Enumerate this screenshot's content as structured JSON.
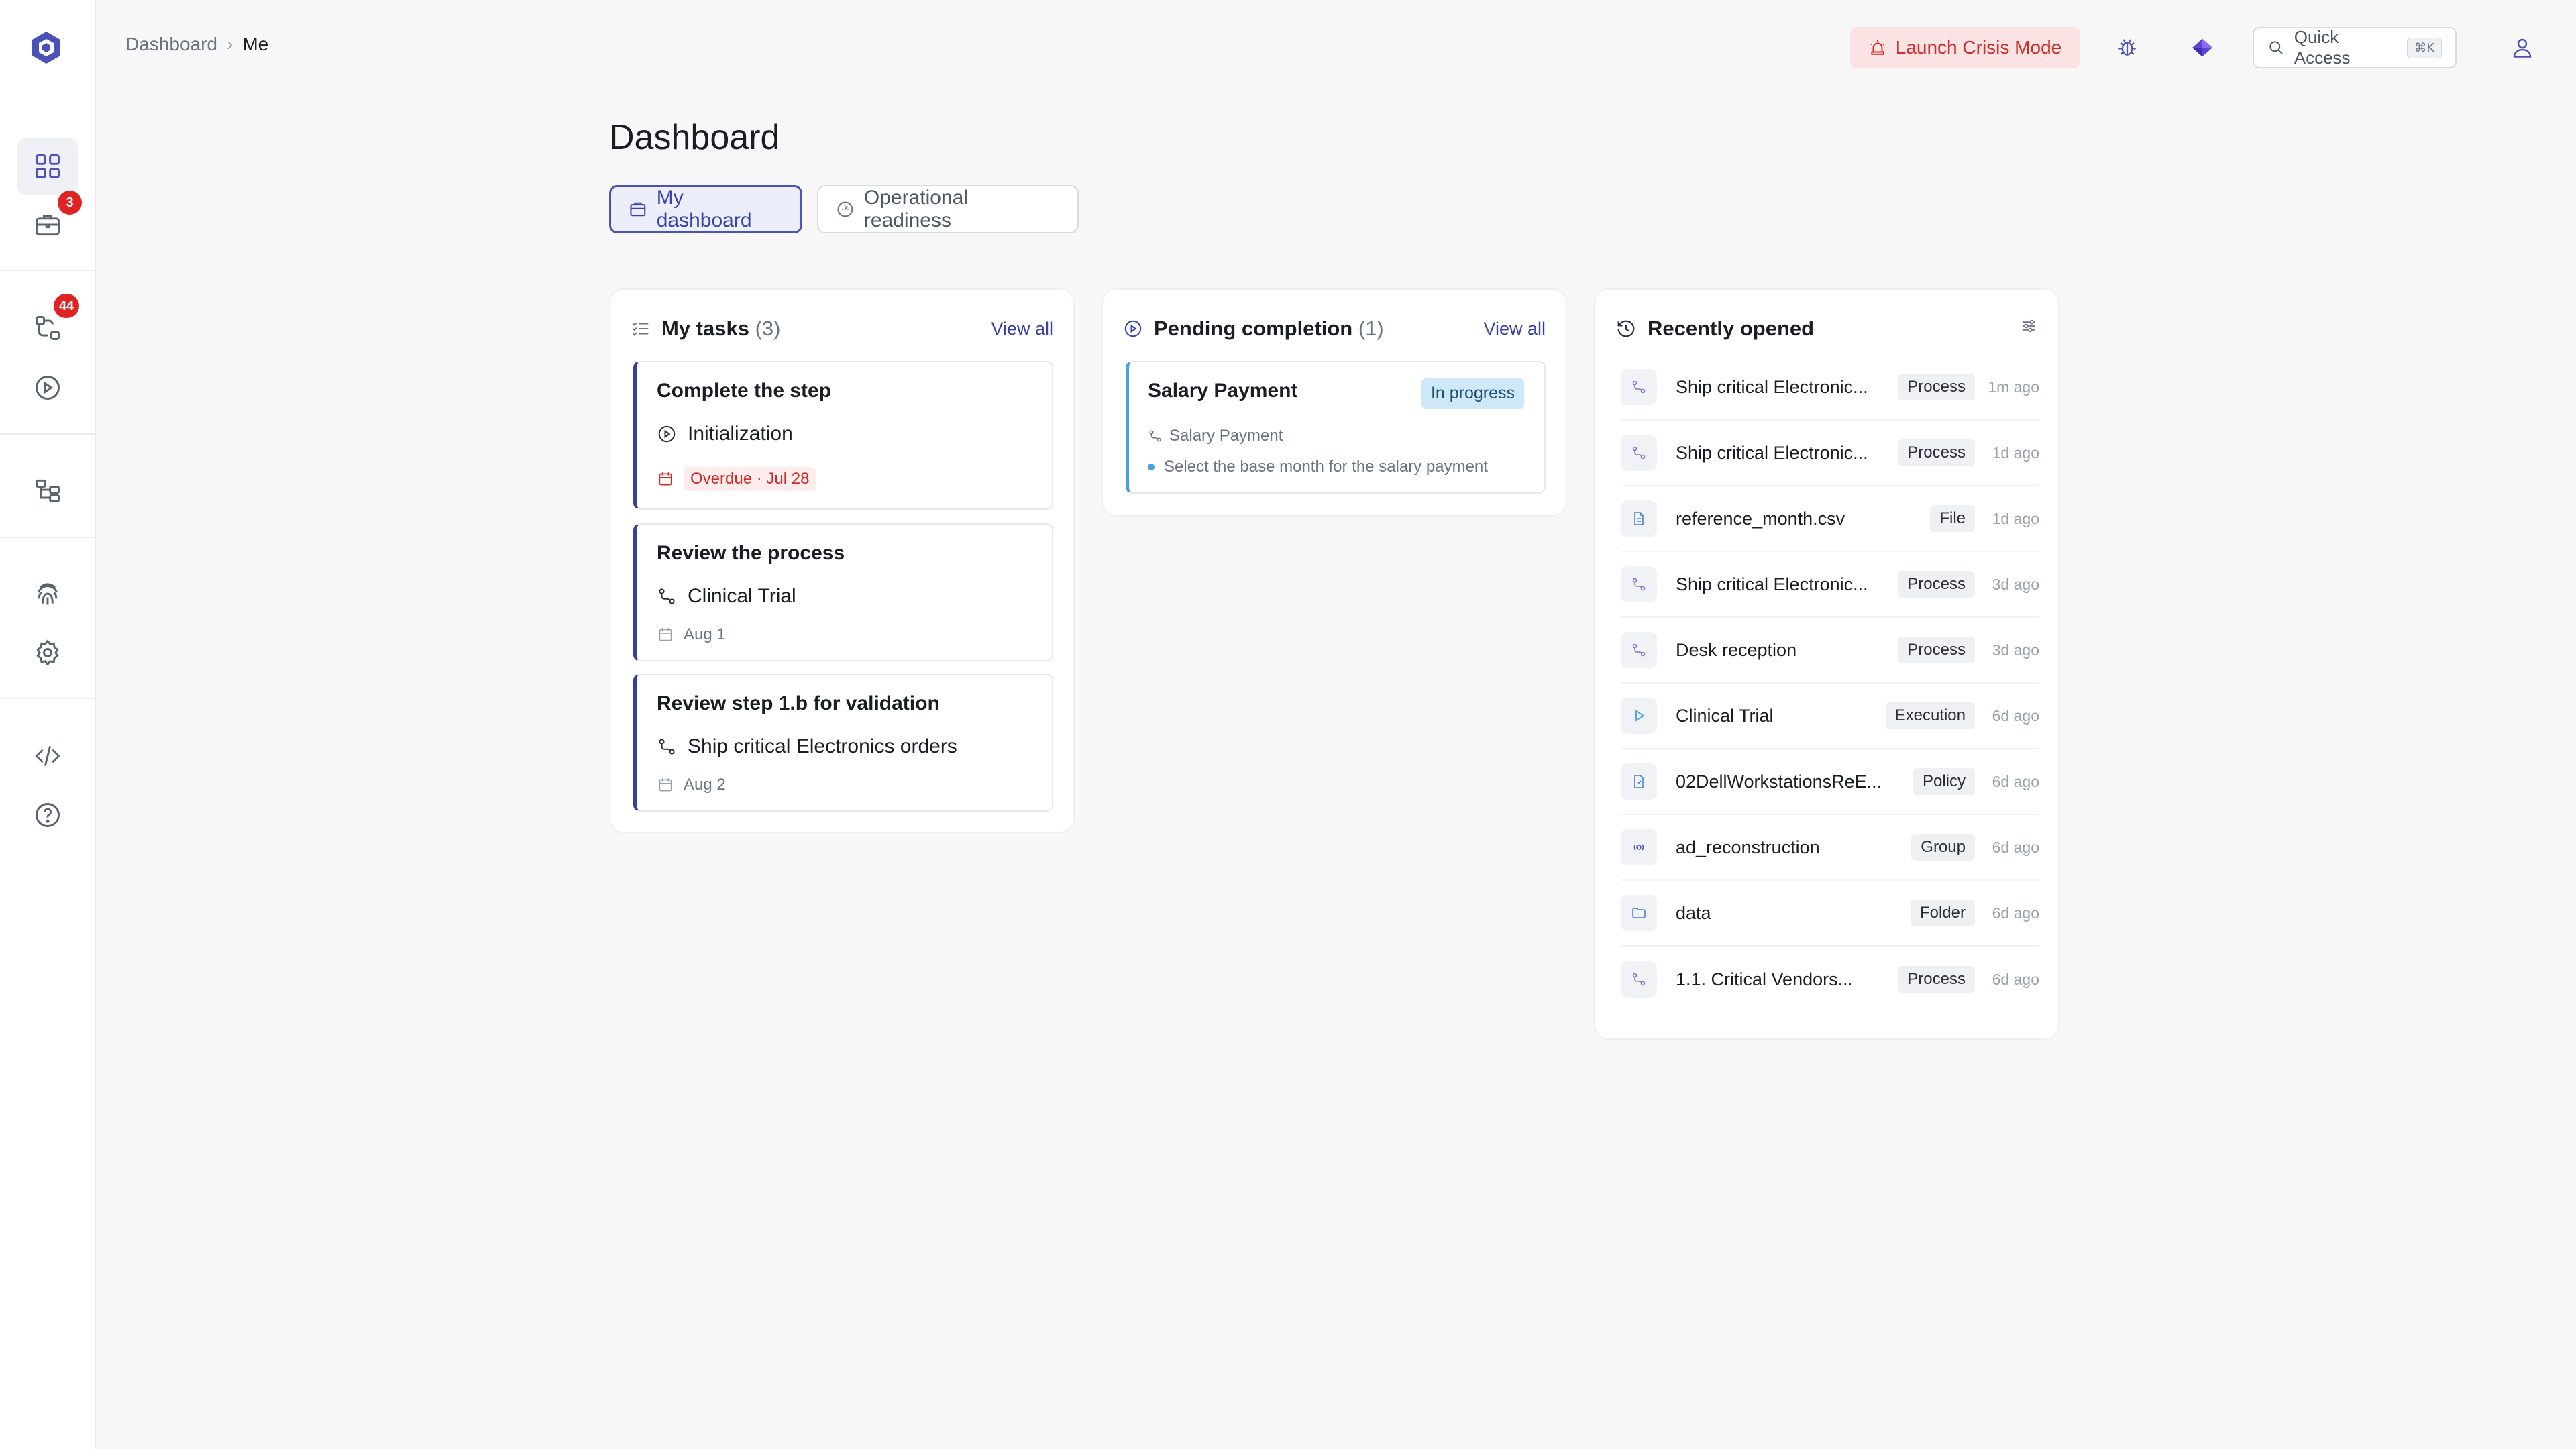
{
  "breadcrumb": {
    "root": "Dashboard",
    "current": "Me"
  },
  "topbar": {
    "crisis_label": "Launch Crisis Mode",
    "quick_access_label": "Quick Access",
    "quick_access_shortcut": "⌘K"
  },
  "sidebar": {
    "badges": {
      "cases": "3",
      "processes": "44"
    }
  },
  "page": {
    "title": "Dashboard"
  },
  "tabs": [
    {
      "label": "My dashboard"
    },
    {
      "label": "Operational readiness"
    }
  ],
  "my_tasks": {
    "title": "My tasks",
    "count": "(3)",
    "view_all": "View all",
    "items": [
      {
        "title": "Complete the step",
        "ref": "Initialization",
        "date": "Overdue · Jul 28"
      },
      {
        "title": "Review the process",
        "ref": "Clinical Trial",
        "date": "Aug 1"
      },
      {
        "title": "Review step 1.b for validation",
        "ref": "Ship critical Electronics orders",
        "date": "Aug 2"
      }
    ]
  },
  "pending": {
    "title": "Pending completion",
    "count": "(1)",
    "view_all": "View all",
    "item": {
      "title": "Salary Payment",
      "status": "In progress",
      "ref": "Salary Payment",
      "step": "Select the base month for the salary payment"
    }
  },
  "recent": {
    "title": "Recently opened",
    "items": [
      {
        "name": "Ship critical Electronic...",
        "type": "Process",
        "time": "1m ago",
        "icon": "process-icon"
      },
      {
        "name": "Ship critical Electronic...",
        "type": "Process",
        "time": "1d ago",
        "icon": "process-icon"
      },
      {
        "name": "reference_month.csv",
        "type": "File",
        "time": "1d ago",
        "icon": "file-icon"
      },
      {
        "name": "Ship critical Electronic...",
        "type": "Process",
        "time": "3d ago",
        "icon": "process-icon"
      },
      {
        "name": "Desk reception",
        "type": "Process",
        "time": "3d ago",
        "icon": "process-icon"
      },
      {
        "name": "Clinical Trial",
        "type": "Execution",
        "time": "6d ago",
        "icon": "play-icon"
      },
      {
        "name": "02DellWorkstationsReE...",
        "type": "Policy",
        "time": "6d ago",
        "icon": "policy-icon"
      },
      {
        "name": "ad_reconstruction",
        "type": "Group",
        "time": "6d ago",
        "icon": "group-icon"
      },
      {
        "name": "data",
        "type": "Folder",
        "time": "6d ago",
        "icon": "folder-icon"
      },
      {
        "name": "1.1. Critical Vendors...",
        "type": "Process",
        "time": "6d ago",
        "icon": "process-icon"
      }
    ]
  },
  "colors": {
    "accent": "#3a42a8",
    "danger": "#d02b2b",
    "info": "#4a9fe0"
  }
}
